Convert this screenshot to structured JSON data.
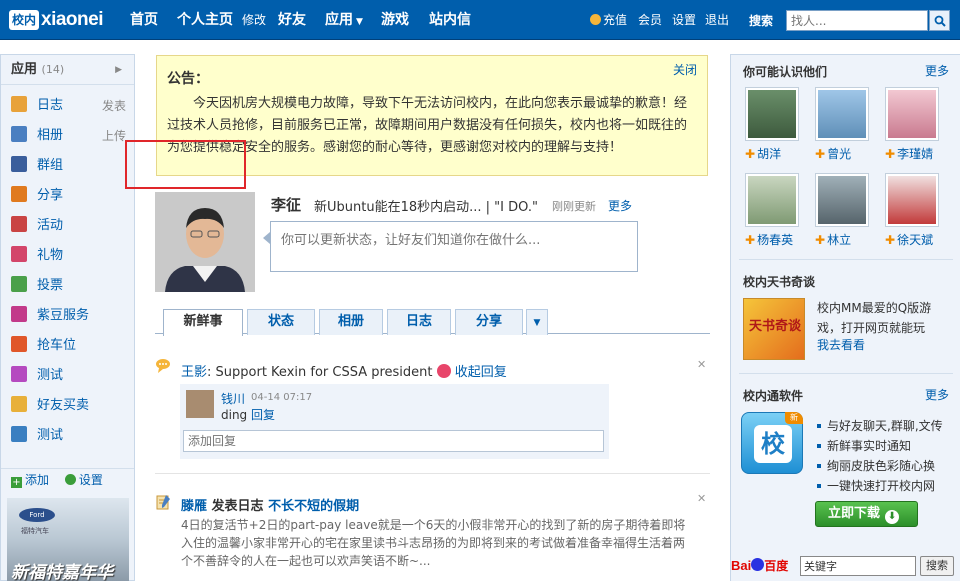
{
  "topbar": {
    "logo_box": "校内",
    "logo_text": "xiaonei",
    "nav": [
      "首页",
      "个人主页",
      "修改",
      "好友",
      "应用",
      "游戏",
      "站内信"
    ],
    "right_links": [
      "充值",
      "会员",
      "设置",
      "退出"
    ],
    "search_label": "搜索",
    "search_placeholder": "找人..."
  },
  "sidebar": {
    "title": "应用",
    "count": "(14)",
    "items": [
      {
        "label": "日志",
        "action": "发表",
        "icon": "journal-icon",
        "color": "#e8a23a"
      },
      {
        "label": "相册",
        "action": "上传",
        "icon": "album-icon",
        "color": "#4a7fc1"
      },
      {
        "label": "群组",
        "action": "",
        "icon": "group-icon",
        "color": "#3a5e9c"
      },
      {
        "label": "分享",
        "action": "",
        "icon": "share-icon",
        "color": "#e07a1f"
      },
      {
        "label": "活动",
        "action": "",
        "icon": "event-icon",
        "color": "#c94444"
      },
      {
        "label": "礼物",
        "action": "",
        "icon": "gift-icon",
        "color": "#d3456a"
      },
      {
        "label": "投票",
        "action": "",
        "icon": "vote-icon",
        "color": "#4aa04a"
      },
      {
        "label": "紫豆服务",
        "action": "",
        "icon": "purple-bean-icon",
        "color": "#c23a8a"
      },
      {
        "label": "抢车位",
        "action": "",
        "icon": "parking-icon",
        "color": "#e0572a"
      },
      {
        "label": "测试",
        "action": "",
        "icon": "test-flask-icon",
        "color": "#b54ac0"
      },
      {
        "label": "好友买卖",
        "action": "",
        "icon": "trade-icon",
        "color": "#e8b03a"
      },
      {
        "label": "测试",
        "action": "",
        "icon": "test-chart-icon",
        "color": "#3a7fc1"
      }
    ],
    "add_label": "添加",
    "settings_label": "设置",
    "ad_brand": "Ford",
    "ad_sub": "福特汽车",
    "ad_text": "新福特嘉年华"
  },
  "notice": {
    "title": "公告：",
    "close": "关闭",
    "body": "今天因机房大规模电力故障，导致下午无法访问校内，在此向您表示最诚挚的歉意！经过技术人员抢修，目前服务已正常，故障期间用户数据没有任何损失，校内也将一如既往的为您提供稳定安全的服务。感谢您的耐心等待，更感谢您对校内的理解与支持！"
  },
  "profile": {
    "name": "李征",
    "status": "新Ubuntu能在18秒内启动... | \"I DO.\"",
    "time": "刚刚更新",
    "more": "更多",
    "status_placeholder": "你可以更新状态，让好友们知道你在做什么..."
  },
  "tabs": [
    "新鲜事",
    "状态",
    "相册",
    "日志",
    "分享"
  ],
  "feed1": {
    "user": "王影",
    "text": ": Support Kexin for CSSA president",
    "collapse": "收起回复",
    "reply_user": "钱川",
    "reply_time": "04-14 07:17",
    "reply_text": "ding",
    "reply_link": "回复",
    "reply_placeholder": "添加回复"
  },
  "feed2": {
    "user": "滕雁",
    "action": "发表日志",
    "title": "不长不短的假期",
    "body": "4日的复活节+2日的part-pay leave就是一个6天的小假非常开心的找到了新的房子期待着即将入住的温馨小家非常开心的宅在家里读书斗志昂扬的为即将到来的考试做着准备幸福得生活着两个不善辞令的人在一起也可以欢声笑语不断~..."
  },
  "right": {
    "pymk_title": "你可能认识他们",
    "pymk_more": "更多",
    "friends": [
      "胡洋",
      "曾光",
      "李瑾婧",
      "杨春英",
      "林立",
      "徐天斌"
    ],
    "book_title": "校内天书奇谈",
    "book_desc": "校内MM最爱的Q版游戏，打开网页就能玩",
    "book_link": "我去看看",
    "book_cover_text": "天书奇谈",
    "im_title": "校内通软件",
    "im_more": "更多",
    "im_box_char": "校",
    "im_box_tag": "新",
    "im_features": [
      "与好友聊天,群聊,文传",
      "新鲜事实时通知",
      "绚丽皮肤色彩随心换",
      "一键快速打开校内网"
    ],
    "download": "立即下载"
  },
  "baidu": {
    "logo": "Bai",
    "logo2": "百度",
    "input_value": "关键字",
    "button": "搜索"
  }
}
